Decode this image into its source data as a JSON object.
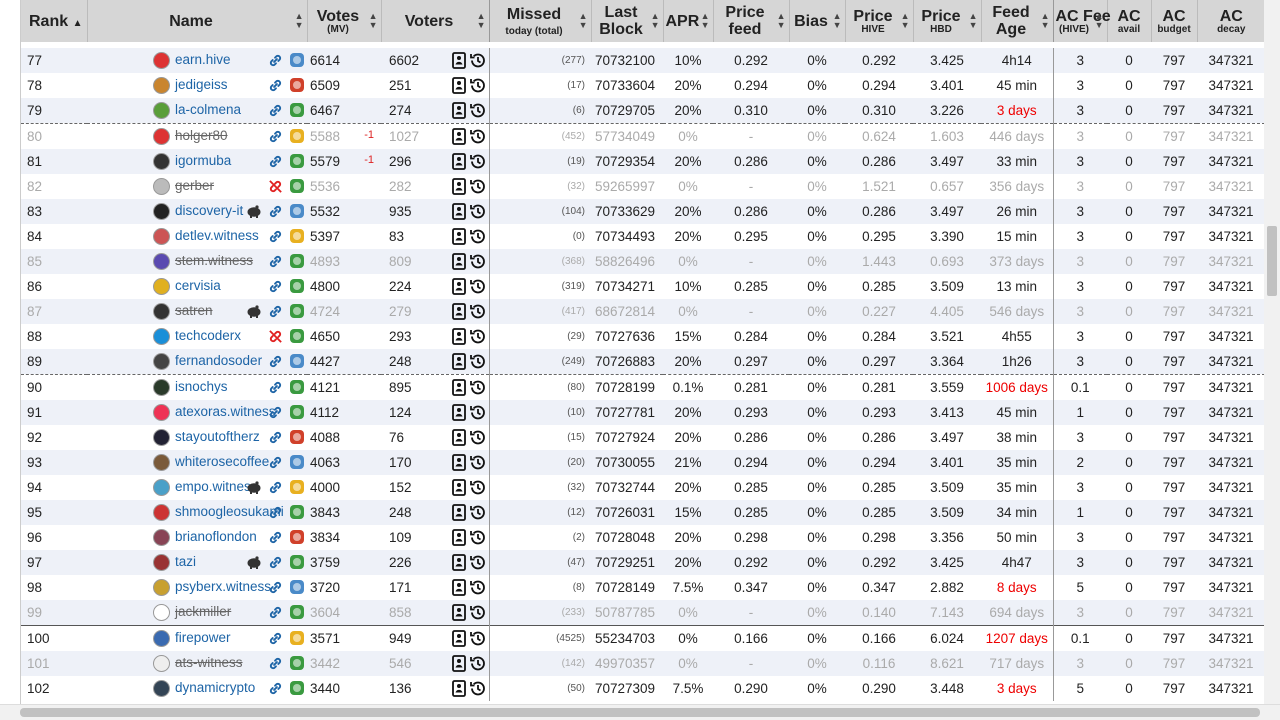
{
  "headers": {
    "rank": "Rank",
    "name": "Name",
    "votes": "Votes",
    "votes_sub": "(MV)",
    "voters": "Voters",
    "missed": "Missed",
    "missed_sub": "today (total)",
    "last_block_1": "Last",
    "last_block_2": "Block",
    "apr": "APR",
    "price_feed_1": "Price",
    "price_feed_2": "feed",
    "bias": "Bias",
    "price_hive": "Price",
    "price_hive_sub": "HIVE",
    "price_hbd": "Price",
    "price_hbd_sub": "HBD",
    "feed_age_1": "Feed",
    "feed_age_2": "Age",
    "ac_fee": "AC Fee",
    "ac_fee_sub": "(HIVE)",
    "ac_avail": "AC",
    "ac_avail_sub": "avail",
    "ac_budget": "AC",
    "ac_budget_sub": "budget",
    "ac_decay": "AC",
    "ac_decay_sub": "decay"
  },
  "colors": {
    "header_bg": "#d6d6d6",
    "link": "#1d64a6",
    "warning": "#e00000",
    "row_alt": "#eef1f8"
  },
  "rows": [
    {
      "rank": "77",
      "name": "earn.hive",
      "votes": "6614",
      "delta": "",
      "voters": "6602",
      "missed": "(277)",
      "block": "70732100",
      "apr": "10%",
      "feed": "0.292",
      "bias": "0%",
      "phive": "0.292",
      "phbd": "3.425",
      "age": "4h14",
      "age_red": false,
      "fee": "3",
      "avail": "0",
      "budget": "797",
      "decay": "347321",
      "dis": false,
      "grp": "",
      "link": "ok",
      "badge": "blue",
      "pig": false,
      "av": "#d33"
    },
    {
      "rank": "78",
      "name": "jedigeiss",
      "votes": "6509",
      "delta": "",
      "voters": "251",
      "missed": "(17)",
      "block": "70733604",
      "apr": "20%",
      "feed": "0.294",
      "bias": "0%",
      "phive": "0.294",
      "phbd": "3.401",
      "age": "45 min",
      "age_red": false,
      "fee": "3",
      "avail": "0",
      "budget": "797",
      "decay": "347321",
      "dis": false,
      "grp": "",
      "link": "ok",
      "badge": "red",
      "pig": false,
      "av": "#c9852f"
    },
    {
      "rank": "79",
      "name": "la-colmena",
      "votes": "6467",
      "delta": "",
      "voters": "274",
      "missed": "(6)",
      "block": "70729705",
      "apr": "20%",
      "feed": "0.310",
      "bias": "0%",
      "phive": "0.310",
      "phbd": "3.226",
      "age": "3 days",
      "age_red": true,
      "fee": "3",
      "avail": "0",
      "budget": "797",
      "decay": "347321",
      "dis": false,
      "grp": "",
      "link": "ok",
      "badge": "green",
      "pig": false,
      "av": "#5a9e3a"
    },
    {
      "rank": "80",
      "name": "holger80",
      "votes": "5588",
      "delta": "-1",
      "voters": "1027",
      "missed": "(452)",
      "block": "57734049",
      "apr": "0%",
      "feed": "-",
      "bias": "0%",
      "phive": "0.624",
      "phbd": "1.603",
      "age": "446 days",
      "age_red": false,
      "fee": "3",
      "avail": "0",
      "budget": "797",
      "decay": "347321",
      "dis": true,
      "grp": "dash",
      "link": "ok",
      "badge": "yellow",
      "pig": false,
      "av": "#d33"
    },
    {
      "rank": "81",
      "name": "igormuba",
      "votes": "5579",
      "delta": "-1",
      "voters": "296",
      "missed": "(19)",
      "block": "70729354",
      "apr": "20%",
      "feed": "0.286",
      "bias": "0%",
      "phive": "0.286",
      "phbd": "3.497",
      "age": "33 min",
      "age_red": false,
      "fee": "3",
      "avail": "0",
      "budget": "797",
      "decay": "347321",
      "dis": false,
      "grp": "",
      "link": "ok",
      "badge": "green",
      "pig": false,
      "av": "#333"
    },
    {
      "rank": "82",
      "name": "gerber",
      "votes": "5536",
      "delta": "",
      "voters": "282",
      "missed": "(32)",
      "block": "59265997",
      "apr": "0%",
      "feed": "-",
      "bias": "0%",
      "phive": "1.521",
      "phbd": "0.657",
      "age": "356 days",
      "age_red": false,
      "fee": "3",
      "avail": "0",
      "budget": "797",
      "decay": "347321",
      "dis": true,
      "grp": "",
      "link": "broken",
      "badge": "green",
      "pig": false,
      "av": "#bbb"
    },
    {
      "rank": "83",
      "name": "discovery-it",
      "votes": "5532",
      "delta": "",
      "voters": "935",
      "missed": "(104)",
      "block": "70733629",
      "apr": "20%",
      "feed": "0.286",
      "bias": "0%",
      "phive": "0.286",
      "phbd": "3.497",
      "age": "26 min",
      "age_red": false,
      "fee": "3",
      "avail": "0",
      "budget": "797",
      "decay": "347321",
      "dis": false,
      "grp": "",
      "link": "ok",
      "badge": "blue",
      "pig": true,
      "av": "#222"
    },
    {
      "rank": "84",
      "name": "detlev.witness",
      "votes": "5397",
      "delta": "",
      "voters": "83",
      "missed": "(0)",
      "block": "70734493",
      "apr": "20%",
      "feed": "0.295",
      "bias": "0%",
      "phive": "0.295",
      "phbd": "3.390",
      "age": "15 min",
      "age_red": false,
      "fee": "3",
      "avail": "0",
      "budget": "797",
      "decay": "347321",
      "dis": false,
      "grp": "",
      "link": "ok",
      "badge": "yellow",
      "pig": false,
      "av": "#c55"
    },
    {
      "rank": "85",
      "name": "stem.witness",
      "votes": "4893",
      "delta": "",
      "voters": "809",
      "missed": "(368)",
      "block": "58826496",
      "apr": "0%",
      "feed": "-",
      "bias": "0%",
      "phive": "1.443",
      "phbd": "0.693",
      "age": "373 days",
      "age_red": false,
      "fee": "3",
      "avail": "0",
      "budget": "797",
      "decay": "347321",
      "dis": true,
      "grp": "",
      "link": "ok",
      "badge": "green",
      "pig": false,
      "av": "#5a4ab0"
    },
    {
      "rank": "86",
      "name": "cervisia",
      "votes": "4800",
      "delta": "",
      "voters": "224",
      "missed": "(319)",
      "block": "70734271",
      "apr": "10%",
      "feed": "0.285",
      "bias": "0%",
      "phive": "0.285",
      "phbd": "3.509",
      "age": "13 min",
      "age_red": false,
      "fee": "3",
      "avail": "0",
      "budget": "797",
      "decay": "347321",
      "dis": false,
      "grp": "",
      "link": "ok",
      "badge": "green",
      "pig": false,
      "av": "#e0b020"
    },
    {
      "rank": "87",
      "name": "satren",
      "votes": "4724",
      "delta": "",
      "voters": "279",
      "missed": "(417)",
      "block": "68672814",
      "apr": "0%",
      "feed": "-",
      "bias": "0%",
      "phive": "0.227",
      "phbd": "4.405",
      "age": "546 days",
      "age_red": false,
      "fee": "3",
      "avail": "0",
      "budget": "797",
      "decay": "347321",
      "dis": true,
      "grp": "",
      "link": "ok",
      "badge": "green",
      "pig": true,
      "av": "#333"
    },
    {
      "rank": "88",
      "name": "techcoderx",
      "votes": "4650",
      "delta": "",
      "voters": "293",
      "missed": "(29)",
      "block": "70727636",
      "apr": "15%",
      "feed": "0.284",
      "bias": "0%",
      "phive": "0.284",
      "phbd": "3.521",
      "age": "4h55",
      "age_red": false,
      "fee": "3",
      "avail": "0",
      "budget": "797",
      "decay": "347321",
      "dis": false,
      "grp": "",
      "link": "broken",
      "badge": "green",
      "pig": false,
      "av": "#1a8fd8"
    },
    {
      "rank": "89",
      "name": "fernandosoder",
      "votes": "4427",
      "delta": "",
      "voters": "248",
      "missed": "(249)",
      "block": "70726883",
      "apr": "20%",
      "feed": "0.297",
      "bias": "0%",
      "phive": "0.297",
      "phbd": "3.364",
      "age": "1h26",
      "age_red": false,
      "fee": "3",
      "avail": "0",
      "budget": "797",
      "decay": "347321",
      "dis": false,
      "grp": "",
      "link": "ok",
      "badge": "blue",
      "pig": false,
      "av": "#444"
    },
    {
      "rank": "90",
      "name": "isnochys",
      "votes": "4121",
      "delta": "",
      "voters": "895",
      "missed": "(80)",
      "block": "70728199",
      "apr": "0.1%",
      "feed": "0.281",
      "bias": "0%",
      "phive": "0.281",
      "phbd": "3.559",
      "age": "1006 days",
      "age_red": true,
      "fee": "0.1",
      "avail": "0",
      "budget": "797",
      "decay": "347321",
      "dis": false,
      "grp": "dash",
      "link": "ok",
      "badge": "green",
      "pig": false,
      "av": "#2a3a2a"
    },
    {
      "rank": "91",
      "name": "atexoras.witness",
      "votes": "4112",
      "delta": "",
      "voters": "124",
      "missed": "(10)",
      "block": "70727781",
      "apr": "20%",
      "feed": "0.293",
      "bias": "0%",
      "phive": "0.293",
      "phbd": "3.413",
      "age": "45 min",
      "age_red": false,
      "fee": "1",
      "avail": "0",
      "budget": "797",
      "decay": "347321",
      "dis": false,
      "grp": "",
      "link": "ok",
      "badge": "green",
      "pig": false,
      "av": "#e35"
    },
    {
      "rank": "92",
      "name": "stayoutoftherz",
      "votes": "4088",
      "delta": "",
      "voters": "76",
      "missed": "(15)",
      "block": "70727924",
      "apr": "20%",
      "feed": "0.286",
      "bias": "0%",
      "phive": "0.286",
      "phbd": "3.497",
      "age": "38 min",
      "age_red": false,
      "fee": "3",
      "avail": "0",
      "budget": "797",
      "decay": "347321",
      "dis": false,
      "grp": "",
      "link": "ok",
      "badge": "red",
      "pig": false,
      "av": "#223"
    },
    {
      "rank": "93",
      "name": "whiterosecoffee",
      "votes": "4063",
      "delta": "",
      "voters": "170",
      "missed": "(20)",
      "block": "70730055",
      "apr": "21%",
      "feed": "0.294",
      "bias": "0%",
      "phive": "0.294",
      "phbd": "3.401",
      "age": "35 min",
      "age_red": false,
      "fee": "2",
      "avail": "0",
      "budget": "797",
      "decay": "347321",
      "dis": false,
      "grp": "",
      "link": "ok",
      "badge": "blue",
      "pig": false,
      "av": "#7a5a3a"
    },
    {
      "rank": "94",
      "name": "empo.witness",
      "votes": "4000",
      "delta": "",
      "voters": "152",
      "missed": "(32)",
      "block": "70732744",
      "apr": "20%",
      "feed": "0.285",
      "bias": "0%",
      "phive": "0.285",
      "phbd": "3.509",
      "age": "35 min",
      "age_red": false,
      "fee": "3",
      "avail": "0",
      "budget": "797",
      "decay": "347321",
      "dis": false,
      "grp": "",
      "link": "ok",
      "badge": "yellow",
      "pig": true,
      "av": "#4aa0c8"
    },
    {
      "rank": "95",
      "name": "shmoogleosukami",
      "votes": "3843",
      "delta": "",
      "voters": "248",
      "missed": "(12)",
      "block": "70726031",
      "apr": "15%",
      "feed": "0.285",
      "bias": "0%",
      "phive": "0.285",
      "phbd": "3.509",
      "age": "34 min",
      "age_red": false,
      "fee": "1",
      "avail": "0",
      "budget": "797",
      "decay": "347321",
      "dis": false,
      "grp": "",
      "link": "ok",
      "badge": "green",
      "pig": false,
      "av": "#c33"
    },
    {
      "rank": "96",
      "name": "brianoflondon",
      "votes": "3834",
      "delta": "",
      "voters": "109",
      "missed": "(2)",
      "block": "70728048",
      "apr": "20%",
      "feed": "0.298",
      "bias": "0%",
      "phive": "0.298",
      "phbd": "3.356",
      "age": "50 min",
      "age_red": false,
      "fee": "3",
      "avail": "0",
      "budget": "797",
      "decay": "347321",
      "dis": false,
      "grp": "",
      "link": "ok",
      "badge": "red",
      "pig": false,
      "av": "#845"
    },
    {
      "rank": "97",
      "name": "tazi",
      "votes": "3759",
      "delta": "",
      "voters": "226",
      "missed": "(47)",
      "block": "70729251",
      "apr": "20%",
      "feed": "0.292",
      "bias": "0%",
      "phive": "0.292",
      "phbd": "3.425",
      "age": "4h47",
      "age_red": false,
      "fee": "3",
      "avail": "0",
      "budget": "797",
      "decay": "347321",
      "dis": false,
      "grp": "",
      "link": "ok",
      "badge": "green",
      "pig": true,
      "av": "#933"
    },
    {
      "rank": "98",
      "name": "psyberx.witness",
      "votes": "3720",
      "delta": "",
      "voters": "171",
      "missed": "(8)",
      "block": "70728149",
      "apr": "7.5%",
      "feed": "0.347",
      "bias": "0%",
      "phive": "0.347",
      "phbd": "2.882",
      "age": "8 days",
      "age_red": true,
      "fee": "5",
      "avail": "0",
      "budget": "797",
      "decay": "347321",
      "dis": false,
      "grp": "",
      "link": "ok",
      "badge": "blue",
      "pig": false,
      "av": "#c8a030"
    },
    {
      "rank": "99",
      "name": "jackmiller",
      "votes": "3604",
      "delta": "",
      "voters": "858",
      "missed": "(233)",
      "block": "50787785",
      "apr": "0%",
      "feed": "-",
      "bias": "0%",
      "phive": "0.140",
      "phbd": "7.143",
      "age": "694 days",
      "age_red": false,
      "fee": "3",
      "avail": "0",
      "budget": "797",
      "decay": "347321",
      "dis": true,
      "grp": "",
      "link": "ok",
      "badge": "green",
      "pig": false,
      "av": "#fff"
    },
    {
      "rank": "100",
      "name": "firepower",
      "votes": "3571",
      "delta": "",
      "voters": "949",
      "missed": "(4525)",
      "block": "55234703",
      "apr": "0%",
      "feed": "0.166",
      "bias": "0%",
      "phive": "0.166",
      "phbd": "6.024",
      "age": "1207 days",
      "age_red": true,
      "fee": "0.1",
      "avail": "0",
      "budget": "797",
      "decay": "347321",
      "dis": false,
      "grp": "solid",
      "link": "ok",
      "badge": "yellow",
      "pig": false,
      "av": "#3a6ab0"
    },
    {
      "rank": "101",
      "name": "ats-witness",
      "votes": "3442",
      "delta": "",
      "voters": "546",
      "missed": "(142)",
      "block": "49970357",
      "apr": "0%",
      "feed": "-",
      "bias": "0%",
      "phive": "0.116",
      "phbd": "8.621",
      "age": "717 days",
      "age_red": false,
      "fee": "3",
      "avail": "0",
      "budget": "797",
      "decay": "347321",
      "dis": true,
      "grp": "",
      "link": "ok",
      "badge": "green",
      "pig": false,
      "av": "#eee"
    },
    {
      "rank": "102",
      "name": "dynamicrypto",
      "votes": "3440",
      "delta": "",
      "voters": "136",
      "missed": "(50)",
      "block": "70727309",
      "apr": "7.5%",
      "feed": "0.290",
      "bias": "0%",
      "phive": "0.290",
      "phbd": "3.448",
      "age": "3 days",
      "age_red": true,
      "fee": "5",
      "avail": "0",
      "budget": "797",
      "decay": "347321",
      "dis": false,
      "grp": "",
      "link": "ok",
      "badge": "green",
      "pig": false,
      "av": "#345"
    }
  ]
}
